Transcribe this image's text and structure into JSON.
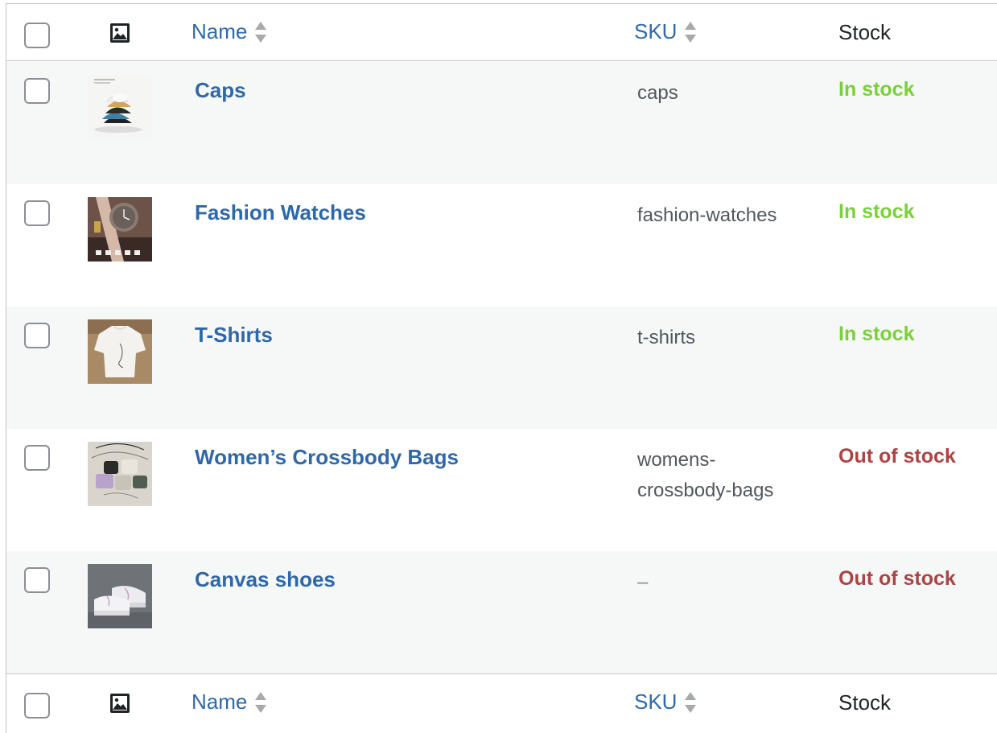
{
  "columns": {
    "name": "Name",
    "sku": "SKU",
    "stock": "Stock"
  },
  "products": [
    {
      "name": "Caps",
      "sku": "caps",
      "stock": "In stock",
      "stock_status": "instock",
      "thumb": "caps-thumbnail"
    },
    {
      "name": "Fashion Watches",
      "sku": "fashion-watches",
      "stock": "In stock",
      "stock_status": "instock",
      "thumb": "watches-thumbnail"
    },
    {
      "name": "T-Shirts",
      "sku": "t-shirts",
      "stock": "In stock",
      "stock_status": "instock",
      "thumb": "tshirt-thumbnail"
    },
    {
      "name": "Women’s Crossbody Bags",
      "sku_line1": "womens-",
      "sku_line2": "crossbody-bags",
      "stock": "Out of stock",
      "stock_status": "outofstock",
      "thumb": "bags-thumbnail"
    },
    {
      "name": "Canvas shoes",
      "sku": "–",
      "stock": "Out of stock",
      "stock_status": "outofstock",
      "thumb": "shoes-thumbnail"
    }
  ],
  "colors": {
    "link": "#2f68a8",
    "in_stock": "#7ad03a",
    "out_of_stock": "#aa4444",
    "row_alt": "#f6f7f7",
    "border": "#c3c4c7"
  }
}
